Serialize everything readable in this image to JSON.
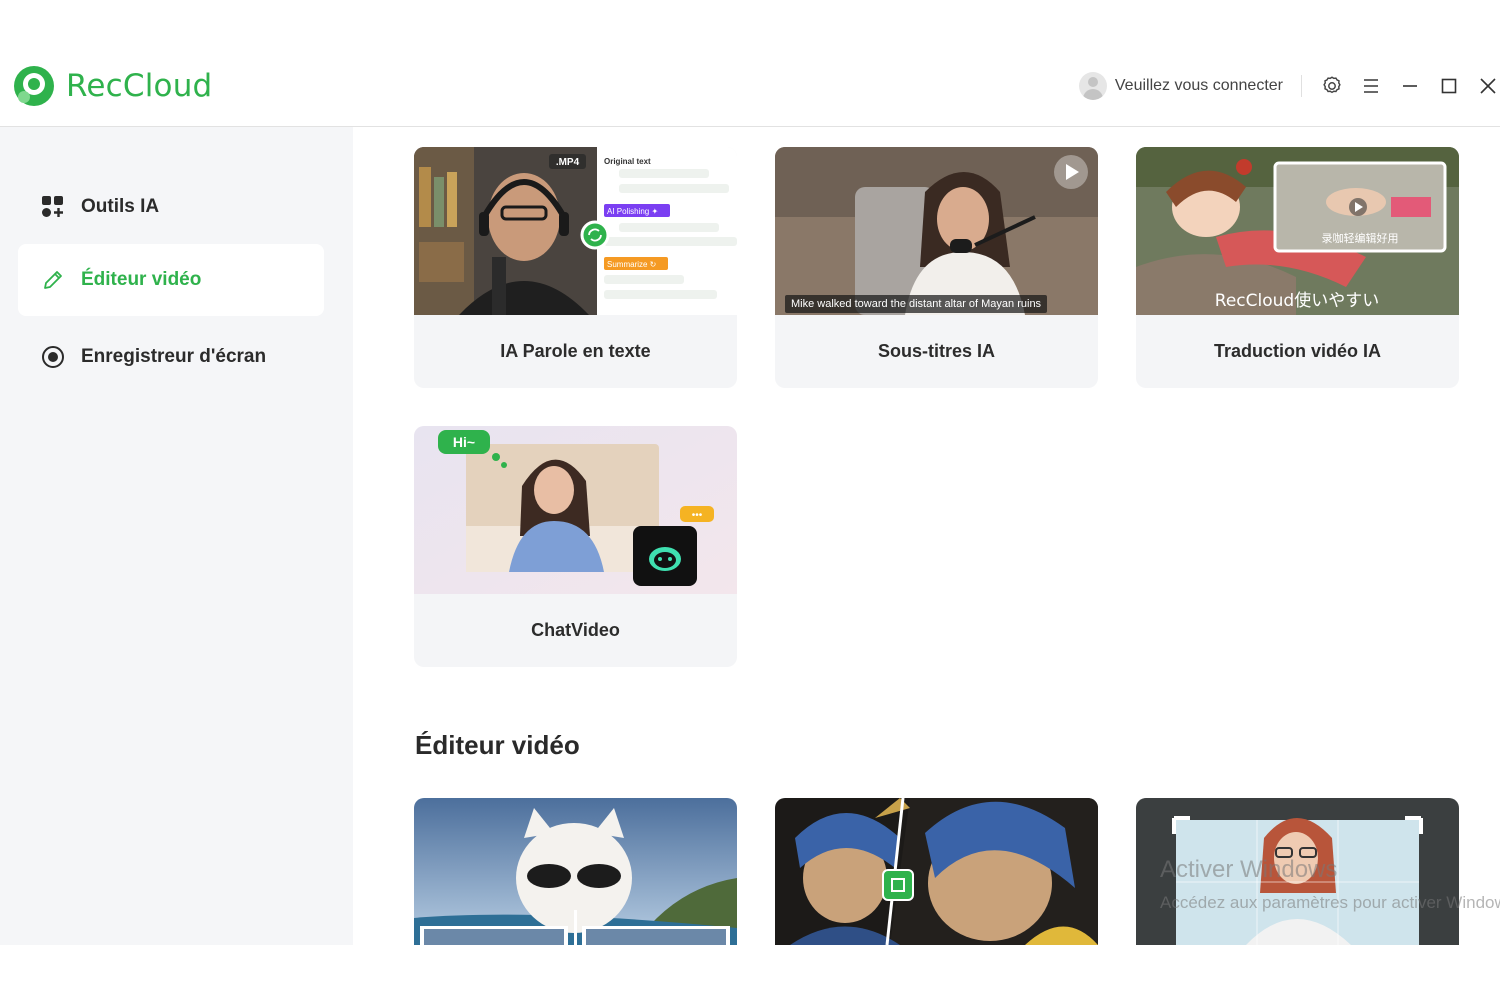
{
  "app": {
    "name": "RecCloud"
  },
  "header": {
    "login_label": "Veuillez vous connecter",
    "icons": [
      "settings-icon",
      "menu-icon",
      "minimize-icon",
      "maximize-icon",
      "close-icon"
    ]
  },
  "sidebar": {
    "items": [
      {
        "label": "Outils IA",
        "icon": "apps-grid-icon",
        "active": false
      },
      {
        "label": "Éditeur vidéo",
        "icon": "pencil-icon",
        "active": true
      },
      {
        "label": "Enregistreur d'écran",
        "icon": "record-icon",
        "active": false
      }
    ]
  },
  "ai_tools": {
    "cards": [
      {
        "title": "IA Parole en texte",
        "thumb": {
          "format_badge": ".MP4",
          "original_label": "Original text",
          "polish_label": "AI Polishing ✦",
          "summarize_label": "Summarize ↻"
        }
      },
      {
        "title": "Sous-titres IA",
        "thumb": {
          "subtitle": "Mike walked toward the distant altar of Mayan ruins"
        }
      },
      {
        "title": "Traduction vidéo IA",
        "thumb": {
          "overlay_text": "RecCloud使いやすい",
          "inset_caption": "录咖轻编辑好用"
        }
      },
      {
        "title": "ChatVideo",
        "thumb": {
          "bubble": "Hi~",
          "typing": "•••"
        }
      }
    ]
  },
  "video_editor": {
    "section_title": "Éditeur vidéo"
  },
  "watermark": {
    "title": "Activer Windows",
    "subtitle": "Accédez aux paramètres pour activer Windows."
  },
  "colors": {
    "brand": "#2fb24c",
    "sidebar_bg": "#f5f6f8",
    "card_bg": "#f4f5f7"
  }
}
